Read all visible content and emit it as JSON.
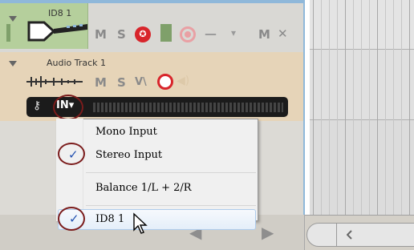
{
  "instrument_track": {
    "name": "ID8 1",
    "mute_label": "M",
    "solo_label": "S",
    "monitor_label": "M",
    "close_label": "✕",
    "dash_label": "—",
    "arrow_label": "▾"
  },
  "audio_track": {
    "name": "Audio Track 1",
    "mute_label": "M",
    "solo_label": "S",
    "monitor_label": "V\\",
    "input_label": "IN▾"
  },
  "input_menu": {
    "items": [
      {
        "label": "Mono Input",
        "checked": false
      },
      {
        "label": "Stereo Input",
        "checked": true
      },
      {
        "label": "Balance 1/L + 2/R",
        "checked": false
      },
      {
        "label": "ID8 1",
        "checked": true,
        "hovered": true
      }
    ],
    "check_glyph": "✓"
  },
  "colors": {
    "instrument_track": "#b5cf9c",
    "audio_track": "#e6d4b8",
    "record_red": "#d8252b",
    "annotation_circle": "#7b1c1c"
  }
}
